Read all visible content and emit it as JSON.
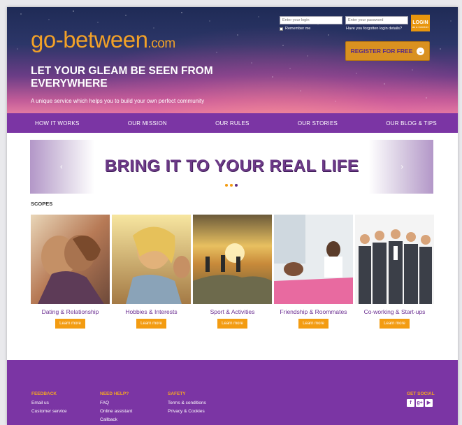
{
  "brand": {
    "logo_main": "go-between",
    "logo_suffix": ".com"
  },
  "login": {
    "login_placeholder": "Enter your login",
    "password_placeholder": "Enter your password",
    "remember": "Remember me",
    "forgot": "Have you forgotten login details?",
    "button_main": "LOGIN",
    "button_sub": "as a member"
  },
  "register": {
    "label": "REGISTER FOR FREE",
    "icon": "chevron-down-icon"
  },
  "hero": {
    "title": "LET YOUR GLEAM BE SEEN FROM EVERYWHERE",
    "subtitle": "A unique service which helps you to build your own perfect community"
  },
  "nav": [
    "HOW IT WORKS",
    "OUR MISSION",
    "OUR RULES",
    "OUR STORIES",
    "OUR BLOG & TIPS"
  ],
  "banner": {
    "text": "BRING IT TO YOUR REAL LIFE",
    "prev": "‹",
    "next": "›",
    "dot_colors": [
      "#f39c12",
      "#f39c12",
      "#5b2d82"
    ]
  },
  "scopes": {
    "title": "SCOPES",
    "cards": [
      {
        "label": "Dating & Relationship",
        "button": "Learn more"
      },
      {
        "label": "Hobbies & Interests",
        "button": "Learn more"
      },
      {
        "label": "Sport & Activities",
        "button": "Learn more"
      },
      {
        "label": "Friendship & Roommates",
        "button": "Learn more"
      },
      {
        "label": "Co-working & Start-ups",
        "button": "Learn more"
      }
    ]
  },
  "footer": {
    "feedback": {
      "head": "FEEDBACK",
      "links": [
        "Email us",
        "Customer service"
      ]
    },
    "help": {
      "head": "NEED HELP?",
      "links": [
        "FAQ",
        "Online assistant",
        "Callback"
      ]
    },
    "safety": {
      "head": "SAFETY",
      "links": [
        "Terms & conditions",
        "Privacy & Cookies"
      ]
    },
    "social": {
      "head": "GET SOCIAL",
      "icons": [
        "facebook-icon",
        "google-plus-icon",
        "youtube-icon"
      ],
      "glyphs": [
        "f",
        "g+",
        "▶"
      ]
    }
  },
  "colors": {
    "brand_orange": "#f2a128",
    "nav_purple": "#7b35a4",
    "accent_purple": "#6b2f92",
    "button_orange": "#f39c12"
  }
}
